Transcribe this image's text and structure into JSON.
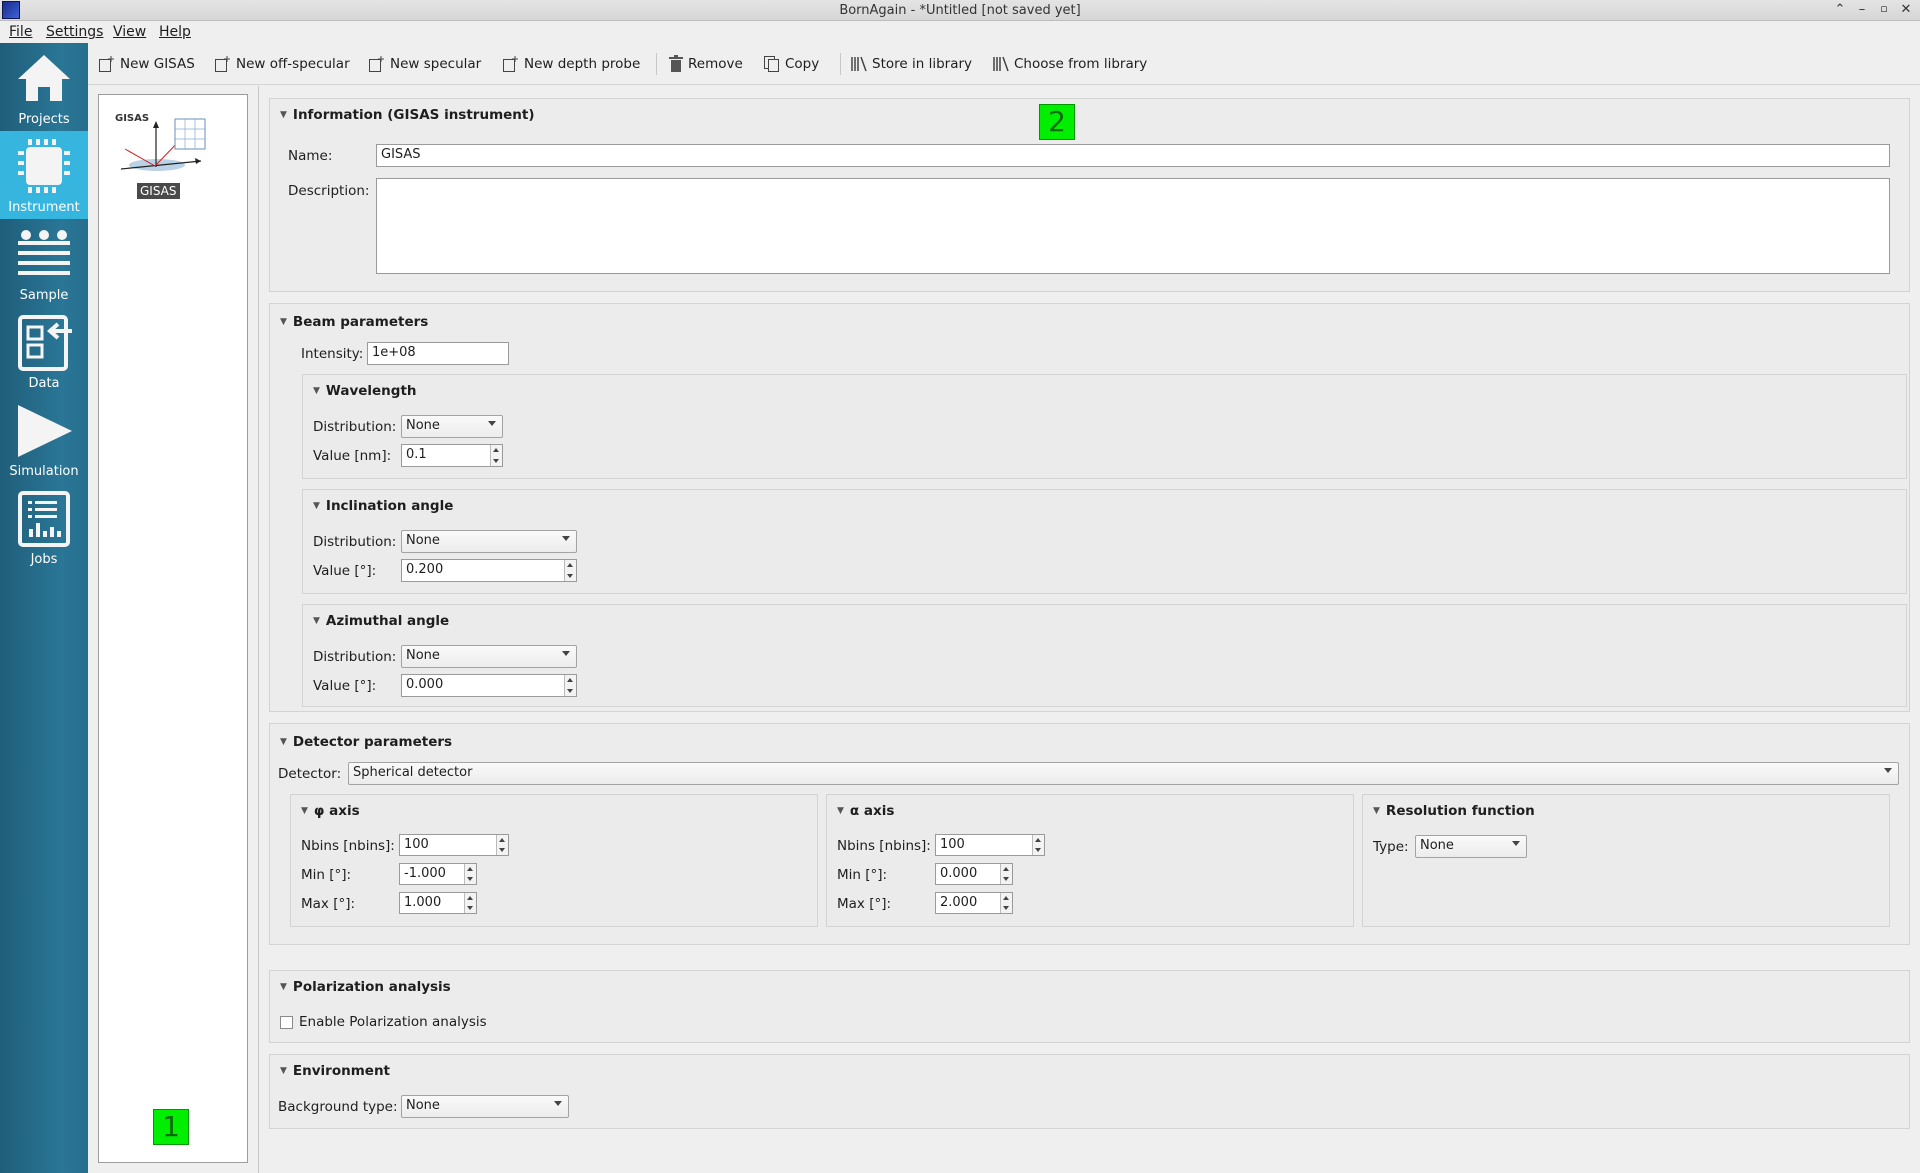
{
  "window": {
    "title": "BornAgain - *Untitled [not saved yet]"
  },
  "menu": [
    {
      "label": "File"
    },
    {
      "label": "Settings"
    },
    {
      "label": "View"
    },
    {
      "label": "Help"
    }
  ],
  "sidebar": {
    "items": [
      {
        "label": "Projects",
        "icon": "home-icon"
      },
      {
        "label": "Instrument",
        "icon": "chip-icon",
        "active": true
      },
      {
        "label": "Sample",
        "icon": "layers-icon"
      },
      {
        "label": "Data",
        "icon": "import-data-icon"
      },
      {
        "label": "Simulation",
        "icon": "play-icon"
      },
      {
        "label": "Jobs",
        "icon": "jobs-chart-icon"
      }
    ]
  },
  "toolbar": {
    "new_gisas": "New GISAS",
    "new_offspec": "New off-specular",
    "new_specular": "New specular",
    "new_depth_probe": "New depth probe",
    "remove": "Remove",
    "copy": "Copy",
    "store": "Store in library",
    "choose": "Choose from library"
  },
  "instrument_list": {
    "items": [
      {
        "tag": "GISAS",
        "name": "GISAS"
      }
    ]
  },
  "markers": {
    "one": "1",
    "two": "2"
  },
  "information": {
    "header": "Information (GISAS instrument)",
    "name_label": "Name:",
    "name_value": "GISAS",
    "description_label": "Description:",
    "description_value": ""
  },
  "beam": {
    "header": "Beam parameters",
    "intensity_label": "Intensity:",
    "intensity_value": "1e+08",
    "wavelength": {
      "header": "Wavelength",
      "distribution_label": "Distribution:",
      "distribution_value": "None",
      "value_label": "Value [nm]:",
      "value": "0.1"
    },
    "inclination": {
      "header": "Inclination angle",
      "distribution_label": "Distribution:",
      "distribution_value": "None",
      "value_label": "Value [°]:",
      "value": "0.200"
    },
    "azimuthal": {
      "header": "Azimuthal angle",
      "distribution_label": "Distribution:",
      "distribution_value": "None",
      "value_label": "Value [°]:",
      "value": "0.000"
    }
  },
  "detector": {
    "header": "Detector parameters",
    "detector_label": "Detector:",
    "detector_value": "Spherical detector",
    "phi": {
      "header": "φ axis",
      "nbins_label": "Nbins [nbins]:",
      "nbins": "100",
      "min_label": "Min [°]:",
      "min": "-1.000",
      "max_label": "Max [°]:",
      "max": "1.000"
    },
    "alpha": {
      "header": "α axis",
      "nbins_label": "Nbins [nbins]:",
      "nbins": "100",
      "min_label": "Min [°]:",
      "min": "0.000",
      "max_label": "Max [°]:",
      "max": "2.000"
    },
    "resolution": {
      "header": "Resolution function",
      "type_label": "Type:",
      "type_value": "None"
    }
  },
  "polarization": {
    "header": "Polarization analysis",
    "enable_label": "Enable Polarization analysis",
    "enabled": false
  },
  "environment": {
    "header": "Environment",
    "background_label": "Background type:",
    "background_value": "None"
  }
}
